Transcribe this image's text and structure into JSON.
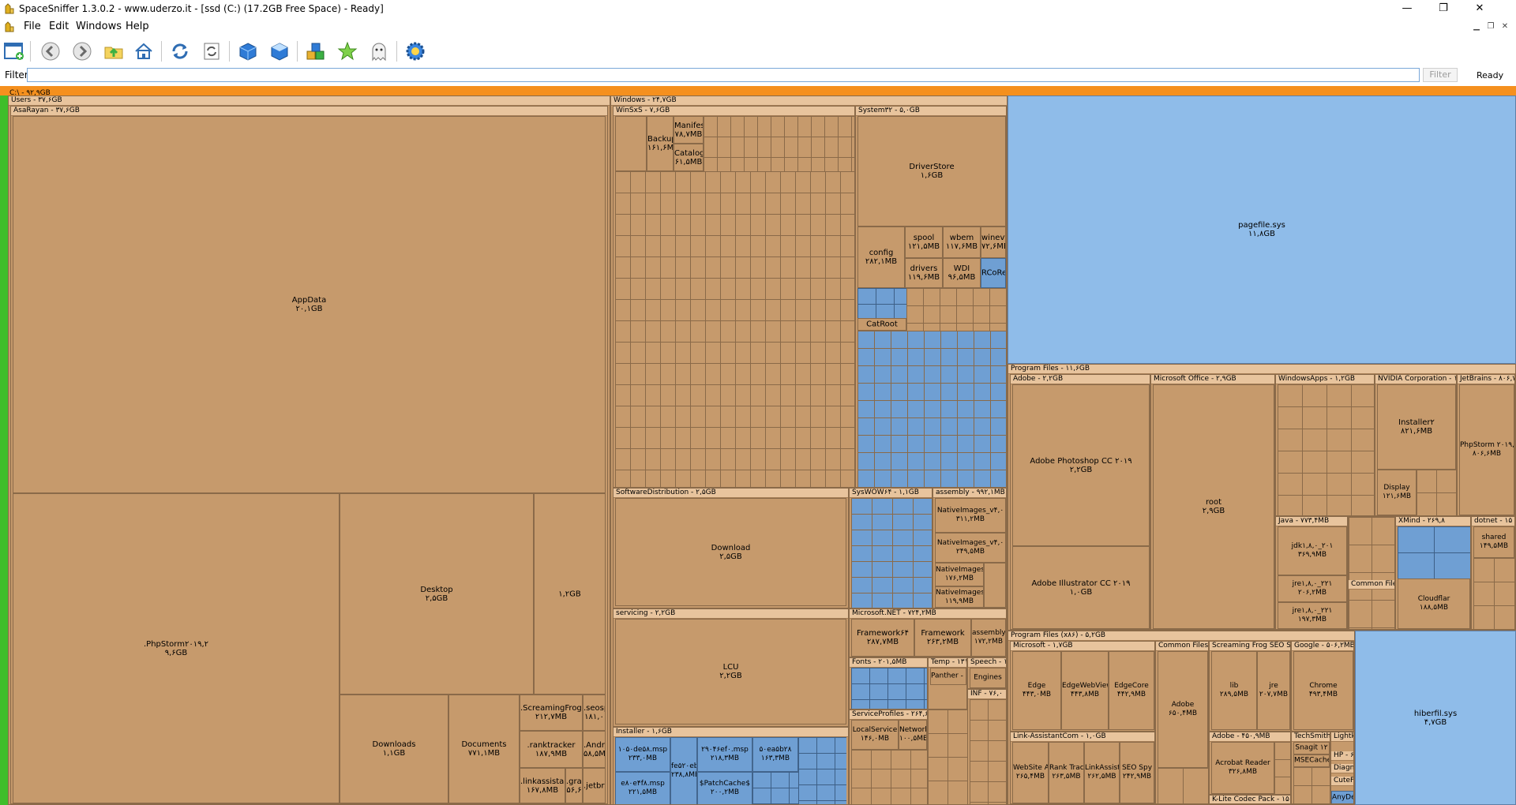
{
  "window": {
    "title": "SpaceSniffer 1.3.0.2 - www.uderzo.it - [ssd (C:) (17.2GB Free Space) - Ready]",
    "minimize": "—",
    "restore": "❐",
    "close": "✕"
  },
  "menu": {
    "file": "File",
    "edit": "Edit",
    "windows": "Windows",
    "help": "Help"
  },
  "toolbar": {
    "icons": [
      "new-scan-icon",
      "back-icon",
      "forward-icon",
      "folder-up-icon",
      "home-icon",
      "refresh-icon",
      "refresh-list-icon",
      "cube-icon",
      "cube-outline-icon",
      "packages-icon",
      "star-icon",
      "ghost-icon",
      "gear-icon"
    ]
  },
  "filter": {
    "label": "Filter",
    "value": "",
    "button": "Filter",
    "status": "Ready"
  },
  "treemap": {
    "root": "C:\\ - ۹۲,۹GB",
    "users": {
      "label": "Users - ۳۷,۶GB",
      "asarayan": "AsaRayan - ۳۷,۶GB",
      "appdata": {
        "name": "AppData",
        "size": "۲۰,۱GB"
      },
      "phpstorm": {
        "name": ".PhpStorm۲۰۱۹,۲",
        "size": "۹,۶GB"
      },
      "desktop": {
        "name": "Desktop",
        "size": "۲,۵GB"
      },
      "unnamed": {
        "name": "",
        "size": "۱,۲GB"
      },
      "downloads": {
        "name": "Downloads",
        "size": "۱,۱GB"
      },
      "documents": {
        "name": "Documents",
        "size": "۷۷۱,۱MB"
      },
      "screamingfrog": {
        "name": ".ScreamingFrogSEO",
        "size": "۲۱۲,۷MB"
      },
      "seosp": {
        "name": ".seosp",
        "size": "۱۸۱,۰"
      },
      "ranktracker": {
        "name": ".ranktracker",
        "size": "۱۸۷,۹MB"
      },
      "linkassistant": {
        "name": ".linkassistant",
        "size": "۱۶۷,۸MB"
      },
      "grad": {
        "name": ".grad",
        "size": "۵۶,۶"
      },
      "android": {
        "name": ".Androi",
        "size": "۵۸,۵MB"
      },
      "jetbrains": {
        "name": ".jetbrain",
        "size": ""
      }
    },
    "windows": {
      "label": "Windows - ۲۴,۷GB",
      "winsxs": "WinSxS - ۷,۶GB",
      "system32": "System۳۲ - ۵,۰GB",
      "driverstore": {
        "name": "DriverStore",
        "size": "۱,۶GB"
      },
      "config": {
        "name": "config",
        "size": "۲۸۲,۱MB"
      },
      "spool": {
        "name": "spool",
        "size": "۱۲۱,۵MB"
      },
      "wbem": {
        "name": "wbem",
        "size": "۱۱۷,۶MB"
      },
      "winevt": {
        "name": "winevt",
        "size": "۷۲,۶MB"
      },
      "drivers": {
        "name": "drivers",
        "size": "۱۱۹,۶MB"
      },
      "wdi": {
        "name": "WDI",
        "size": "۹۶,۵MB"
      },
      "rcore": {
        "name": "RCoRe",
        "size": ""
      },
      "catroot": {
        "name": "CatRoot",
        "size": ""
      },
      "manifests": {
        "name": "Manifests",
        "size": "۷۸,۷MB"
      },
      "backup": {
        "name": "Backup",
        "size": "۱۶۱,۶MB"
      },
      "catalogs": {
        "name": "Catalogs",
        "size": "۶۱,۵MB"
      },
      "softdist": "SoftwareDistribution - ۲,۵GB",
      "download": {
        "name": "Download",
        "size": "۲,۵GB"
      },
      "servicing": "servicing - ۲,۲GB",
      "lcu": {
        "name": "LCU",
        "size": "۲,۲GB"
      },
      "installer": "Installer - ۱,۶GB",
      "inst1": {
        "name": "۱۰۵۰de۵۸.msp",
        "size": "۲۳۳,۰MB"
      },
      "inst2": {
        "name": "۲۹۰۴۶ef۰.msp",
        "size": "۲۱۸,۳MB"
      },
      "inst3": {
        "name": "۵۰ea۵b۲۸",
        "size": "۱۶۳,۳MB"
      },
      "inst4": {
        "name": "fe۵۲۰eb",
        "size": "۲۳۸,۸MB"
      },
      "inst5": {
        "name": "e۸۰e۴f۸.msp",
        "size": "۲۲۱,۵MB"
      },
      "inst6": {
        "name": "$PatchCache$",
        "size": "۲۰۰,۲MB"
      },
      "syswow": "SysWOW۶۴ - ۱,۱GB",
      "assembly": "assembly - ۹۹۲,۱MB",
      "nativeimg1": {
        "name": "NativeImages_v۴,۰",
        "size": "۳۱۱,۲MB"
      },
      "nativeimg2": {
        "name": "NativeImages_v۴,۰",
        "size": "۲۴۹,۵MB"
      },
      "nativeimg3": {
        "name": "NativeImages",
        "size": "۱۷۶,۲MB"
      },
      "nativeimg4": {
        "name": "NativeImages",
        "size": "۱۱۹,۹MB"
      },
      "dotnet": "Microsoft.NET - ۷۲۴,۲MB",
      "fw64": {
        "name": "Framework۶۴",
        "size": "۲۸۷,۷MB"
      },
      "fw": {
        "name": "Framework",
        "size": "۲۶۳,۲MB"
      },
      "asm2": {
        "name": "assembly",
        "size": "۱۷۲,۲MB"
      },
      "fonts": "Fonts - ۲۰۱,۵MB",
      "temp": "Temp - ۱۳۱",
      "speech": "Speech - ۱",
      "engines": {
        "name": "Engines",
        "size": ""
      },
      "servprof": "ServiceProfiles - ۲۶۴,۶",
      "localservice": {
        "name": "LocalService",
        "size": "۱۴۶,۰MB"
      },
      "network": {
        "name": "Network",
        "size": "۱۰۰,۵MB"
      },
      "panther": "Panther - ۱",
      "inf": "INF - ۷۶,۰"
    },
    "pagefile": {
      "name": "pagefile.sys",
      "size": "۱۱,۸GB"
    },
    "hiberfil": {
      "name": "hiberfil.sys",
      "size": "۴,۷GB"
    },
    "progfiles": {
      "label": "Program Files - ۱۱,۶GB",
      "adobe": "Adobe - ۲,۲GB",
      "photoshop": {
        "name": "Adobe Photoshop CC ۲۰۱۹",
        "size": "۲,۲GB"
      },
      "illustrator": {
        "name": "Adobe Illustrator CC ۲۰۱۹",
        "size": "۱,۰GB"
      },
      "office": "Microsoft Office - ۲,۹GB",
      "root": {
        "name": "root",
        "size": "۲,۹GB"
      },
      "windowsapps": "WindowsApps - ۱,۲GB",
      "nvidia": "NVIDIA Corporation - ۱",
      "installer2": {
        "name": "Installer۲",
        "size": "۸۲۱,۶MB"
      },
      "jetbrains": "JetBrains - ۸۰۶,۷",
      "phpstorm2": {
        "name": "PhpStorm ۲۰۱۹,",
        "size": "۸۰۶,۶MB"
      },
      "java": "Java - ۷۷۳,۴MB",
      "jdk": {
        "name": "jdk۱,۸,۰_۲۰۱",
        "size": "۳۶۹,۹MB"
      },
      "jre1": {
        "name": "jre۱,۸,۰_۲۲۱",
        "size": "۲۰۶,۲MB"
      },
      "jre2": {
        "name": "jre۱,۸,۰_۲۲۱",
        "size": "۱۹۷,۳MB"
      },
      "xmind": "XMind - ۲۶۹,۸",
      "commonfiles": "Common Files",
      "dotnet2": "dotnet - ۱۵",
      "shared": {
        "name": "shared",
        "size": "۱۴۹,۵MB"
      },
      "cloudflare": {
        "name": "Cloudflar",
        "size": "۱۸۸,۵MB"
      },
      "display": {
        "name": "Display",
        "size": "۱۲۱,۶MB"
      }
    },
    "progfilesx86": {
      "label": "Program Files (x۸۶) - ۵,۲GB",
      "microsoft": "Microsoft - ۱,۷GB",
      "edge": {
        "name": "Edge",
        "size": "۴۴۳,۰MB"
      },
      "edgewebview": {
        "name": "EdgeWebView",
        "size": "۴۴۳,۸MB"
      },
      "edgecore": {
        "name": "EdgeCore",
        "size": "۴۴۲,۹MB"
      },
      "commonfiles": "Common Files",
      "adobe": {
        "name": "Adobe",
        "size": "۶۵۰,۴MB"
      },
      "screamingfrog": "Screaming Frog SEO Sp",
      "lib": {
        "name": "lib",
        "size": "۲۸۹,۵MB"
      },
      "jre": {
        "name": "jre",
        "size": "۲۰۷,۷MB"
      },
      "google": "Google - ۵۰۶,۲MB",
      "chrome": {
        "name": "Chrome",
        "size": "۴۹۳,۴MB"
      },
      "linkassistant": "Link-AssistantCom - ۱,۰GB",
      "websiteaud": {
        "name": "WebSite A",
        "size": "۲۶۵,۴MB"
      },
      "ranktrack": {
        "name": "Rank Trac",
        "size": "۲۶۳,۵MB"
      },
      "linkassist": {
        "name": "LinkAssist",
        "size": "۲۶۲,۵MB"
      },
      "seospy": {
        "name": "SEO Spy",
        "size": "۲۴۲,۹MB"
      },
      "adobe2": "Adobe - ۴۵۰,۹MB",
      "acrobat": {
        "name": "Acrobat Reader",
        "size": "۳۲۶,۸MB"
      },
      "techsmith": "TechSmith",
      "snagit": {
        "name": "Snagit ۱۲",
        "size": ""
      },
      "lightkey": "Lightkey",
      "msecache": {
        "name": "MSECache",
        "size": ""
      },
      "hp": "HP - ۶۵",
      "diagno": "Diagno",
      "cuteft": "CuteFT",
      "anydesk": "AnyDe",
      "klite": "K-Lite Codec Pack - ۱۵"
    }
  }
}
